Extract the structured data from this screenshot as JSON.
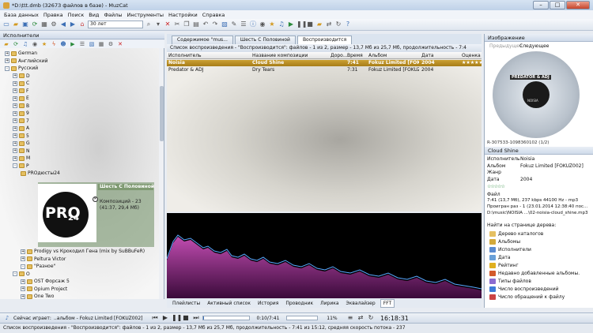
{
  "window": {
    "title": "*D:\\ttt.dmb (32673 файлов в базе) - MuzCat"
  },
  "menu": [
    "База данных",
    "Правка",
    "Поиск",
    "Вид",
    "Файлы",
    "Инструменты",
    "Настройки",
    "Справка"
  ],
  "toolbar": {
    "age_combo": "30 лет"
  },
  "left_panel": {
    "title": "Исполнители",
    "tree": [
      {
        "label": "German",
        "level": 0,
        "exp": "+"
      },
      {
        "label": "Английский",
        "level": 0,
        "exp": "+"
      },
      {
        "label": "Русский",
        "level": 0,
        "exp": "-"
      },
      {
        "label": "D",
        "level": 1,
        "exp": "+"
      },
      {
        "label": "C",
        "level": 1,
        "exp": "+"
      },
      {
        "label": "F",
        "level": 1,
        "exp": "+"
      },
      {
        "label": "E",
        "level": 1,
        "exp": "+"
      },
      {
        "label": "B",
        "level": 1,
        "exp": "+"
      },
      {
        "label": "9",
        "level": 1,
        "exp": "+"
      },
      {
        "label": "7",
        "level": 1,
        "exp": "+"
      },
      {
        "label": "A",
        "level": 1,
        "exp": "+"
      },
      {
        "label": "5",
        "level": 1,
        "exp": "+"
      },
      {
        "label": "G",
        "level": 1,
        "exp": "+"
      },
      {
        "label": "N",
        "level": 1,
        "exp": "+"
      },
      {
        "label": "M",
        "level": 1,
        "exp": "+"
      },
      {
        "label": "P",
        "level": 1,
        "exp": "-"
      },
      {
        "label": "PROдюсты24",
        "level": 2,
        "exp": ""
      }
    ],
    "tree_after": [
      {
        "label": "Prodigy vs Крокодил Гена (mix by SuBBuFeR)",
        "level": 2,
        "exp": "+"
      },
      {
        "label": "Peltura Victor",
        "level": 2,
        "exp": "+"
      },
      {
        "label": "\"Разное\"",
        "level": 2,
        "exp": "-"
      },
      {
        "label": "O",
        "level": 1,
        "exp": "-"
      },
      {
        "label": "OST Форсаж 5",
        "level": 2,
        "exp": "+"
      },
      {
        "label": "Opium Project",
        "level": 2,
        "exp": "+"
      },
      {
        "label": "One Two",
        "level": 2,
        "exp": "+"
      }
    ],
    "album_card": {
      "logo_text": "PRO",
      "logo_num": "24",
      "title": "Шесть С Половиной",
      "compositions": "Композиций - 23",
      "duration": "(41:37, 29,4 Мб)"
    }
  },
  "tabs": [
    {
      "label": "Содержимое \"mus...",
      "active": false
    },
    {
      "label": "Шесть С Половиной",
      "active": false
    },
    {
      "label": "Воспроизводится",
      "active": true
    }
  ],
  "playlist": {
    "title": "Список воспроизведения - \"Воспроизводится\": файлов - 1 из 2, размер - 13,7 Мб из 25,7 Мб, продолжительность - 7:4",
    "columns": [
      "Исполнитель",
      "Название композиции",
      "Доро...",
      "Время",
      "Альбом",
      "Дата",
      "Оценка"
    ],
    "rows": [
      {
        "artist": "Noisia",
        "title": "Cloud Shine",
        "time": "7:41",
        "album": "Fokuz Limited [FOKUZ002]",
        "date": "2004",
        "rating": "★★★★★",
        "selected": true
      },
      {
        "artist": "Predator & ADJ",
        "title": "Dry Tears",
        "time": "7:31",
        "album": "Fokuz Limited [FOKUZ002]",
        "date": "2004",
        "rating": "",
        "selected": false
      }
    ]
  },
  "bottom_tabs": [
    "Плейлисты",
    "Активный список",
    "История",
    "Проводник",
    "Лирика",
    "Эквалайзер",
    "FFT"
  ],
  "right_panel": {
    "image_title": "Изображение",
    "prev_label": "Предыдущее",
    "next_label": "Следующее",
    "disc_text": "PREDATOR & ADJ",
    "disc_sub": "NOISIA",
    "disc_caption": "R-307533-1098360102 (1/2)",
    "info_title": "Cloud Shine",
    "info": [
      {
        "k": "Исполнитель",
        "v": "Noisia"
      },
      {
        "k": "Альбом",
        "v": "Fokuz Limited [FOKUZ002]"
      },
      {
        "k": "Жанр",
        "v": ""
      },
      {
        "k": "Дата",
        "v": "2004"
      }
    ],
    "file_label": "Файл",
    "file_info": "7:41 (13,7 Мб), 237 kbps 44100 Hz - mp3",
    "played_info": "Проигран раз - 1 (23.01.2014 12:38:40 пос...",
    "path": "D:\\music\\NOISIA ...\\02-noisia-cloud_shine.mp3",
    "nav_title": "Найти на странице дерева:",
    "nav": [
      {
        "label": "Дерево каталогов",
        "color": "#e5c062"
      },
      {
        "label": "Альбомы",
        "color": "#d3a93a"
      },
      {
        "label": "Исполнители",
        "color": "#5b8bd0"
      },
      {
        "label": "Дата",
        "color": "#6aa0d8"
      },
      {
        "label": "Рейтинг",
        "color": "#e0b020"
      },
      {
        "label": "Недавно добавленные альбомы.",
        "color": "#d35a2c"
      },
      {
        "label": "Типы файлов",
        "color": "#8b6bd0"
      },
      {
        "label": "Число воспроизведений",
        "color": "#3d7bd8"
      },
      {
        "label": "Число обращений к файлу",
        "color": "#c44"
      }
    ]
  },
  "player": {
    "now_playing": "Сейчас играет:",
    "track": "..альбом - Fokuz Limited [FOKUZ002]",
    "position": "0:10/7:41",
    "volume": "11%",
    "progress": 0.022,
    "clock": "16:18:31"
  },
  "status": "Список воспроизведения - \"Воспроизводится\": файлов - 1 из 2, размер - 13,7 Мб из 25,7 Мб, продолжительность - 7:41 из 15:12, средняя скорость потока - 237"
}
